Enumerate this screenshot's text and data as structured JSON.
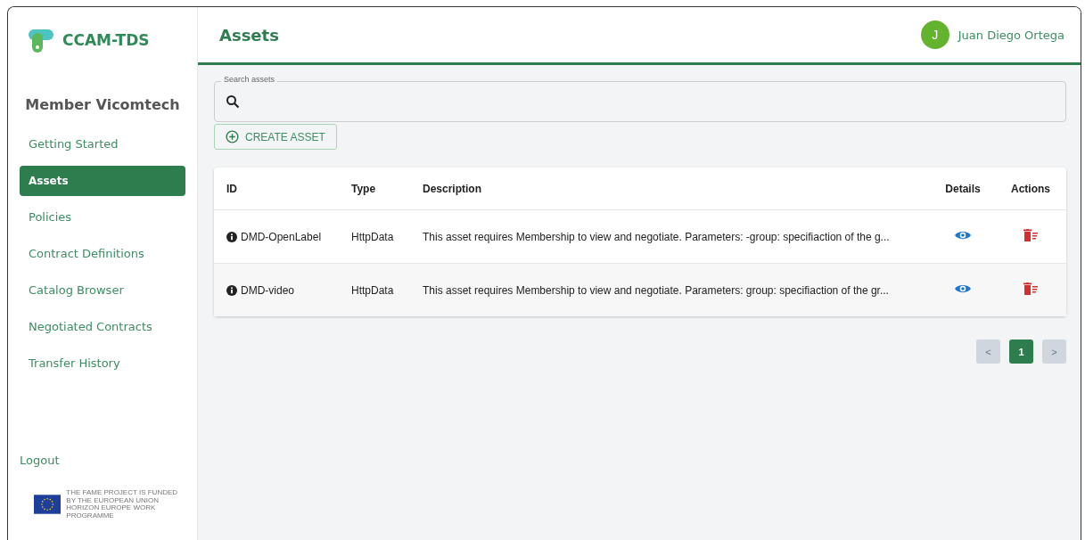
{
  "sidebar": {
    "logo_text": "CCAM-TDS",
    "member": "Member Vicomtech",
    "items": [
      {
        "label": "Getting Started",
        "selected": false
      },
      {
        "label": "Assets",
        "selected": true
      },
      {
        "label": "Policies",
        "selected": false
      },
      {
        "label": "Contract Definitions",
        "selected": false
      },
      {
        "label": "Catalog Browser",
        "selected": false
      },
      {
        "label": "Negotiated Contracts",
        "selected": false
      },
      {
        "label": "Transfer History",
        "selected": false
      }
    ],
    "logout": "Logout",
    "funding_text": "THE FAME PROJECT IS FUNDED BY THE EUROPEAN UNION HORIZON EUROPE WORK PROGRAMME"
  },
  "header": {
    "title": "Assets",
    "user_initial": "J",
    "user_name": "Juan Diego Ortega"
  },
  "search": {
    "label": "Search assets"
  },
  "create_button": "CREATE ASSET",
  "table": {
    "columns": [
      "ID",
      "Type",
      "Description",
      "Details",
      "Actions"
    ],
    "rows": [
      {
        "id": "DMD-OpenLabel",
        "type": "HttpData",
        "description": "This asset requires Membership to view and negotiate. Parameters: -group: specifiaction of the g..."
      },
      {
        "id": "DMD-video",
        "type": "HttpData",
        "description": "This asset requires Membership to view and negotiate. Parameters: group: specifiaction of the gr..."
      }
    ]
  },
  "pagination": {
    "prev": {
      "label": "<",
      "disabled": true
    },
    "pages": [
      {
        "label": "1",
        "selected": true
      }
    ],
    "next": {
      "label": ">",
      "disabled": true
    }
  }
}
